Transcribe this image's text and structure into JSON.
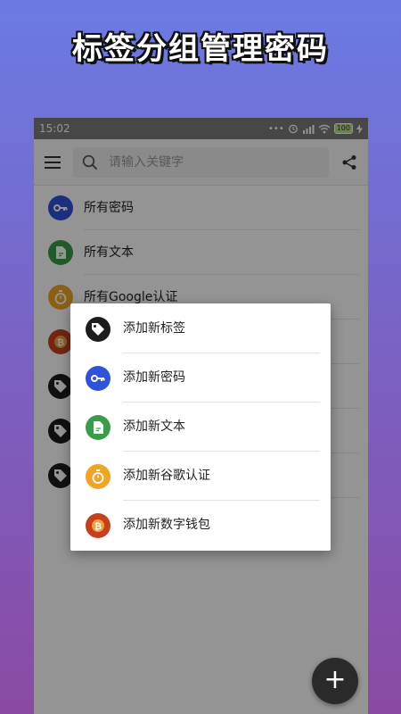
{
  "headline": "标签分组管理密码",
  "status": {
    "time": "15:02",
    "dots": "•••",
    "battery": "100"
  },
  "search": {
    "placeholder": "请输入关键字"
  },
  "list": {
    "items": [
      {
        "label": "所有密码",
        "icon": "key-icon"
      },
      {
        "label": "所有文本",
        "icon": "document-icon"
      },
      {
        "label": "所有Google认证",
        "icon": "stopwatch-icon"
      },
      {
        "label": "",
        "icon": "bitcoin-icon"
      },
      {
        "label": "",
        "icon": "tag-icon"
      },
      {
        "label": "",
        "icon": "tag-icon"
      },
      {
        "label": "",
        "icon": "tag-icon"
      }
    ]
  },
  "dialog": {
    "items": [
      {
        "label": "添加新标签",
        "icon": "tag-icon"
      },
      {
        "label": "添加新密码",
        "icon": "key-icon"
      },
      {
        "label": "添加新文本",
        "icon": "document-icon"
      },
      {
        "label": "添加新谷歌认证",
        "icon": "stopwatch-icon"
      },
      {
        "label": "添加新数字钱包",
        "icon": "bitcoin-icon"
      }
    ]
  },
  "fab": {
    "label": "+"
  },
  "colors": {
    "key": "#2e52d8",
    "document": "#3a9c48",
    "stopwatch": "#f0a526",
    "bitcoin": "#c7401e",
    "tag": "#1d1d1d"
  }
}
